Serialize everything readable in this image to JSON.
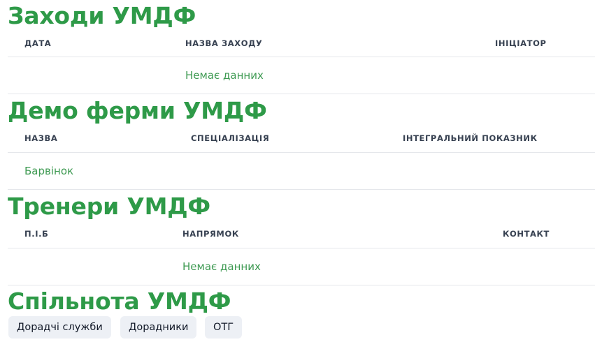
{
  "events": {
    "title": "Заходи УМДФ",
    "headers": [
      "ДАТА",
      "НАЗВА ЗАХОДУ",
      "ІНІЦІАТОР"
    ],
    "empty_text": "Немає данних"
  },
  "demo_farms": {
    "title": "Демо ферми УМДФ",
    "headers": [
      "НАЗВА",
      "СПЕЦІАЛІЗАЦІЯ",
      "ІНТЕГРАЛЬНИЙ ПОКАЗНИК"
    ],
    "rows": [
      {
        "name": "Барвінок",
        "specialization": "",
        "integral_indicator": ""
      }
    ]
  },
  "trainers": {
    "title": "Тренери УМДФ",
    "headers": [
      "П.І.Б",
      "НАПРЯМОК",
      "КОНТАКТ"
    ],
    "empty_text": "Немає данних"
  },
  "community": {
    "title": "Спільнота УМДФ",
    "buttons": [
      "Дорадчі служби",
      "Дорадники",
      "ОТГ"
    ]
  },
  "colors": {
    "heading": "#2e9a48",
    "cell_text": "#3e9a52",
    "header_text": "#374151",
    "chip_bg": "#edf0f5"
  }
}
